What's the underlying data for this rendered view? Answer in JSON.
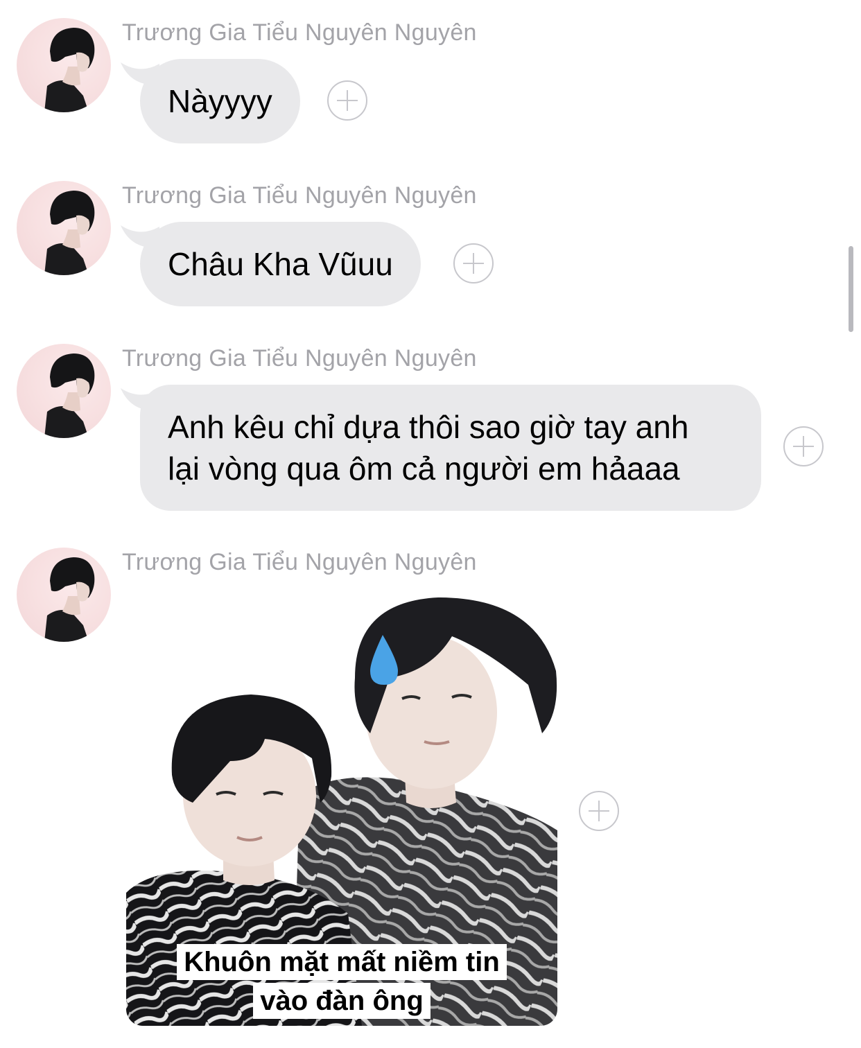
{
  "conversation": {
    "messages": [
      {
        "sender": "Trương Gia Tiểu Nguyên Nguyên",
        "text": "Nàyyyy"
      },
      {
        "sender": "Trương Gia Tiểu Nguyên Nguyên",
        "text": "Châu Kha Vũuu"
      },
      {
        "sender": "Trương Gia Tiểu Nguyên Nguyên",
        "text_lines": [
          "Anh kêu chỉ dựa thôi sao giờ tay anh",
          "lại vòng qua ôm cả người em hảaaa"
        ]
      },
      {
        "sender": "Trương Gia Tiểu Nguyên Nguyên",
        "image_caption_lines": [
          "Khuôn mặt mất niềm tin",
          "vào đàn ông"
        ]
      }
    ]
  },
  "icons": {
    "reaction": "add-reaction-icon",
    "sticker_emoji": "droplet-icon"
  },
  "colors": {
    "bubble": "#e9e9eb",
    "sender_text": "#a3a3a8",
    "reaction_outline": "#c7c7cc"
  }
}
